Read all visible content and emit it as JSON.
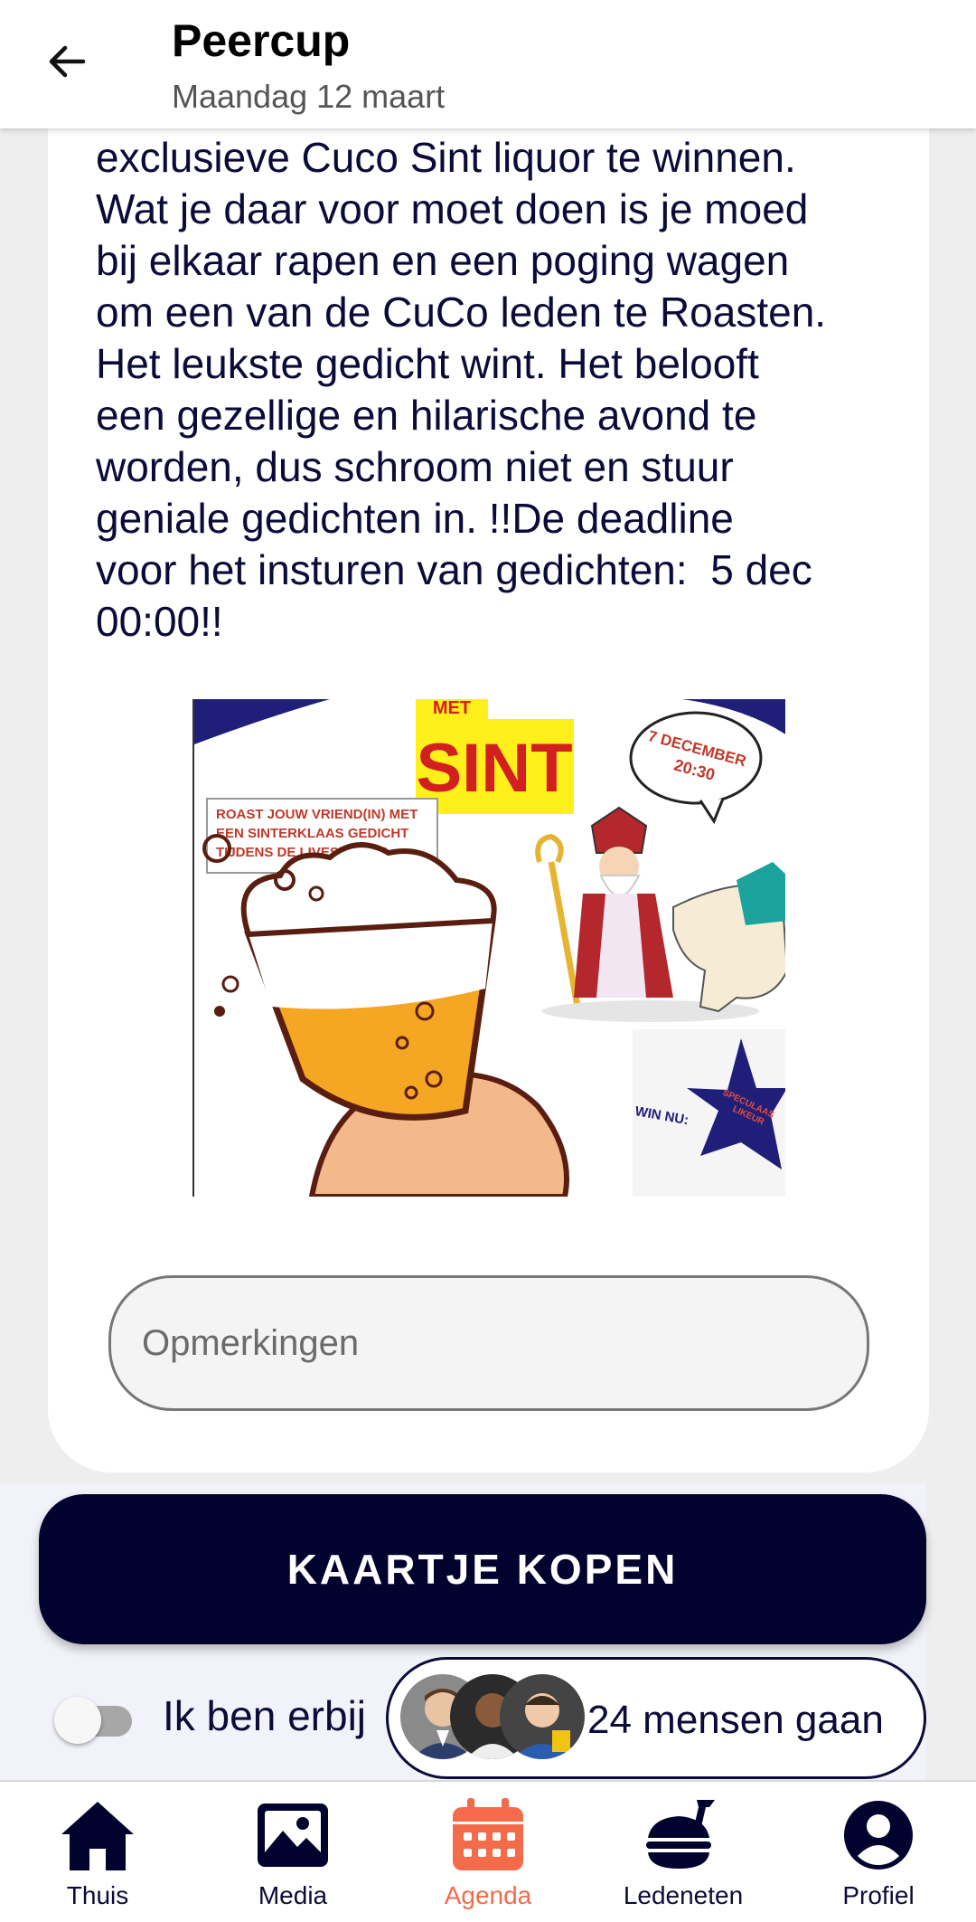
{
  "header": {
    "title": "Peercup",
    "subtitle": "Maandag 12 maart"
  },
  "event": {
    "description": "exclusieve Cuco Sint liquor te winnen.\nWat je daar voor moet doen is je moed\nbij elkaar rapen en een poging wagen\nom een van de CuCo leden te Roasten.\nHet leukste gedicht wint. Het belooft\neen gezellige en hilarische avond te\nworden, dus schroom niet en stuur\ngeniale gedichten in. !!De deadline\nvoor het insturen van gedichten:  5 dec\n00:00!!",
    "poster": {
      "top_word": "MET",
      "sint_text": "SINT",
      "date_bubble_line1": "7 DECEMBER",
      "date_bubble_line2": "20:30",
      "roast_line1": "ROAST JOUW VRIEND(IN) MET",
      "roast_line2": "EEN SINTERKLAAS GEDICHT",
      "roast_line3": "TIJDENS DE LIVESTREAM",
      "win_label": "WIN NU:",
      "star_line1": "SPECULAAS",
      "star_line2": "LIKEUR"
    }
  },
  "remarks": {
    "placeholder": "Opmerkingen",
    "value": ""
  },
  "actions": {
    "buy_label": "KAARTJE KOPEN",
    "attend_label": "Ik ben erbij",
    "attend_toggle_on": false,
    "going_text": "24 mensen gaan"
  },
  "nav": {
    "items": [
      {
        "label": "Thuis",
        "icon": "home-icon",
        "active": false
      },
      {
        "label": "Media",
        "icon": "image-icon",
        "active": false
      },
      {
        "label": "Agenda",
        "icon": "calendar-icon",
        "active": true
      },
      {
        "label": "Ledeneten",
        "icon": "food-icon",
        "active": false
      },
      {
        "label": "Profiel",
        "icon": "profile-icon",
        "active": false
      }
    ]
  },
  "colors": {
    "primary": "#02022f",
    "accent": "#f36b4b",
    "text": "#0b0b3a"
  }
}
